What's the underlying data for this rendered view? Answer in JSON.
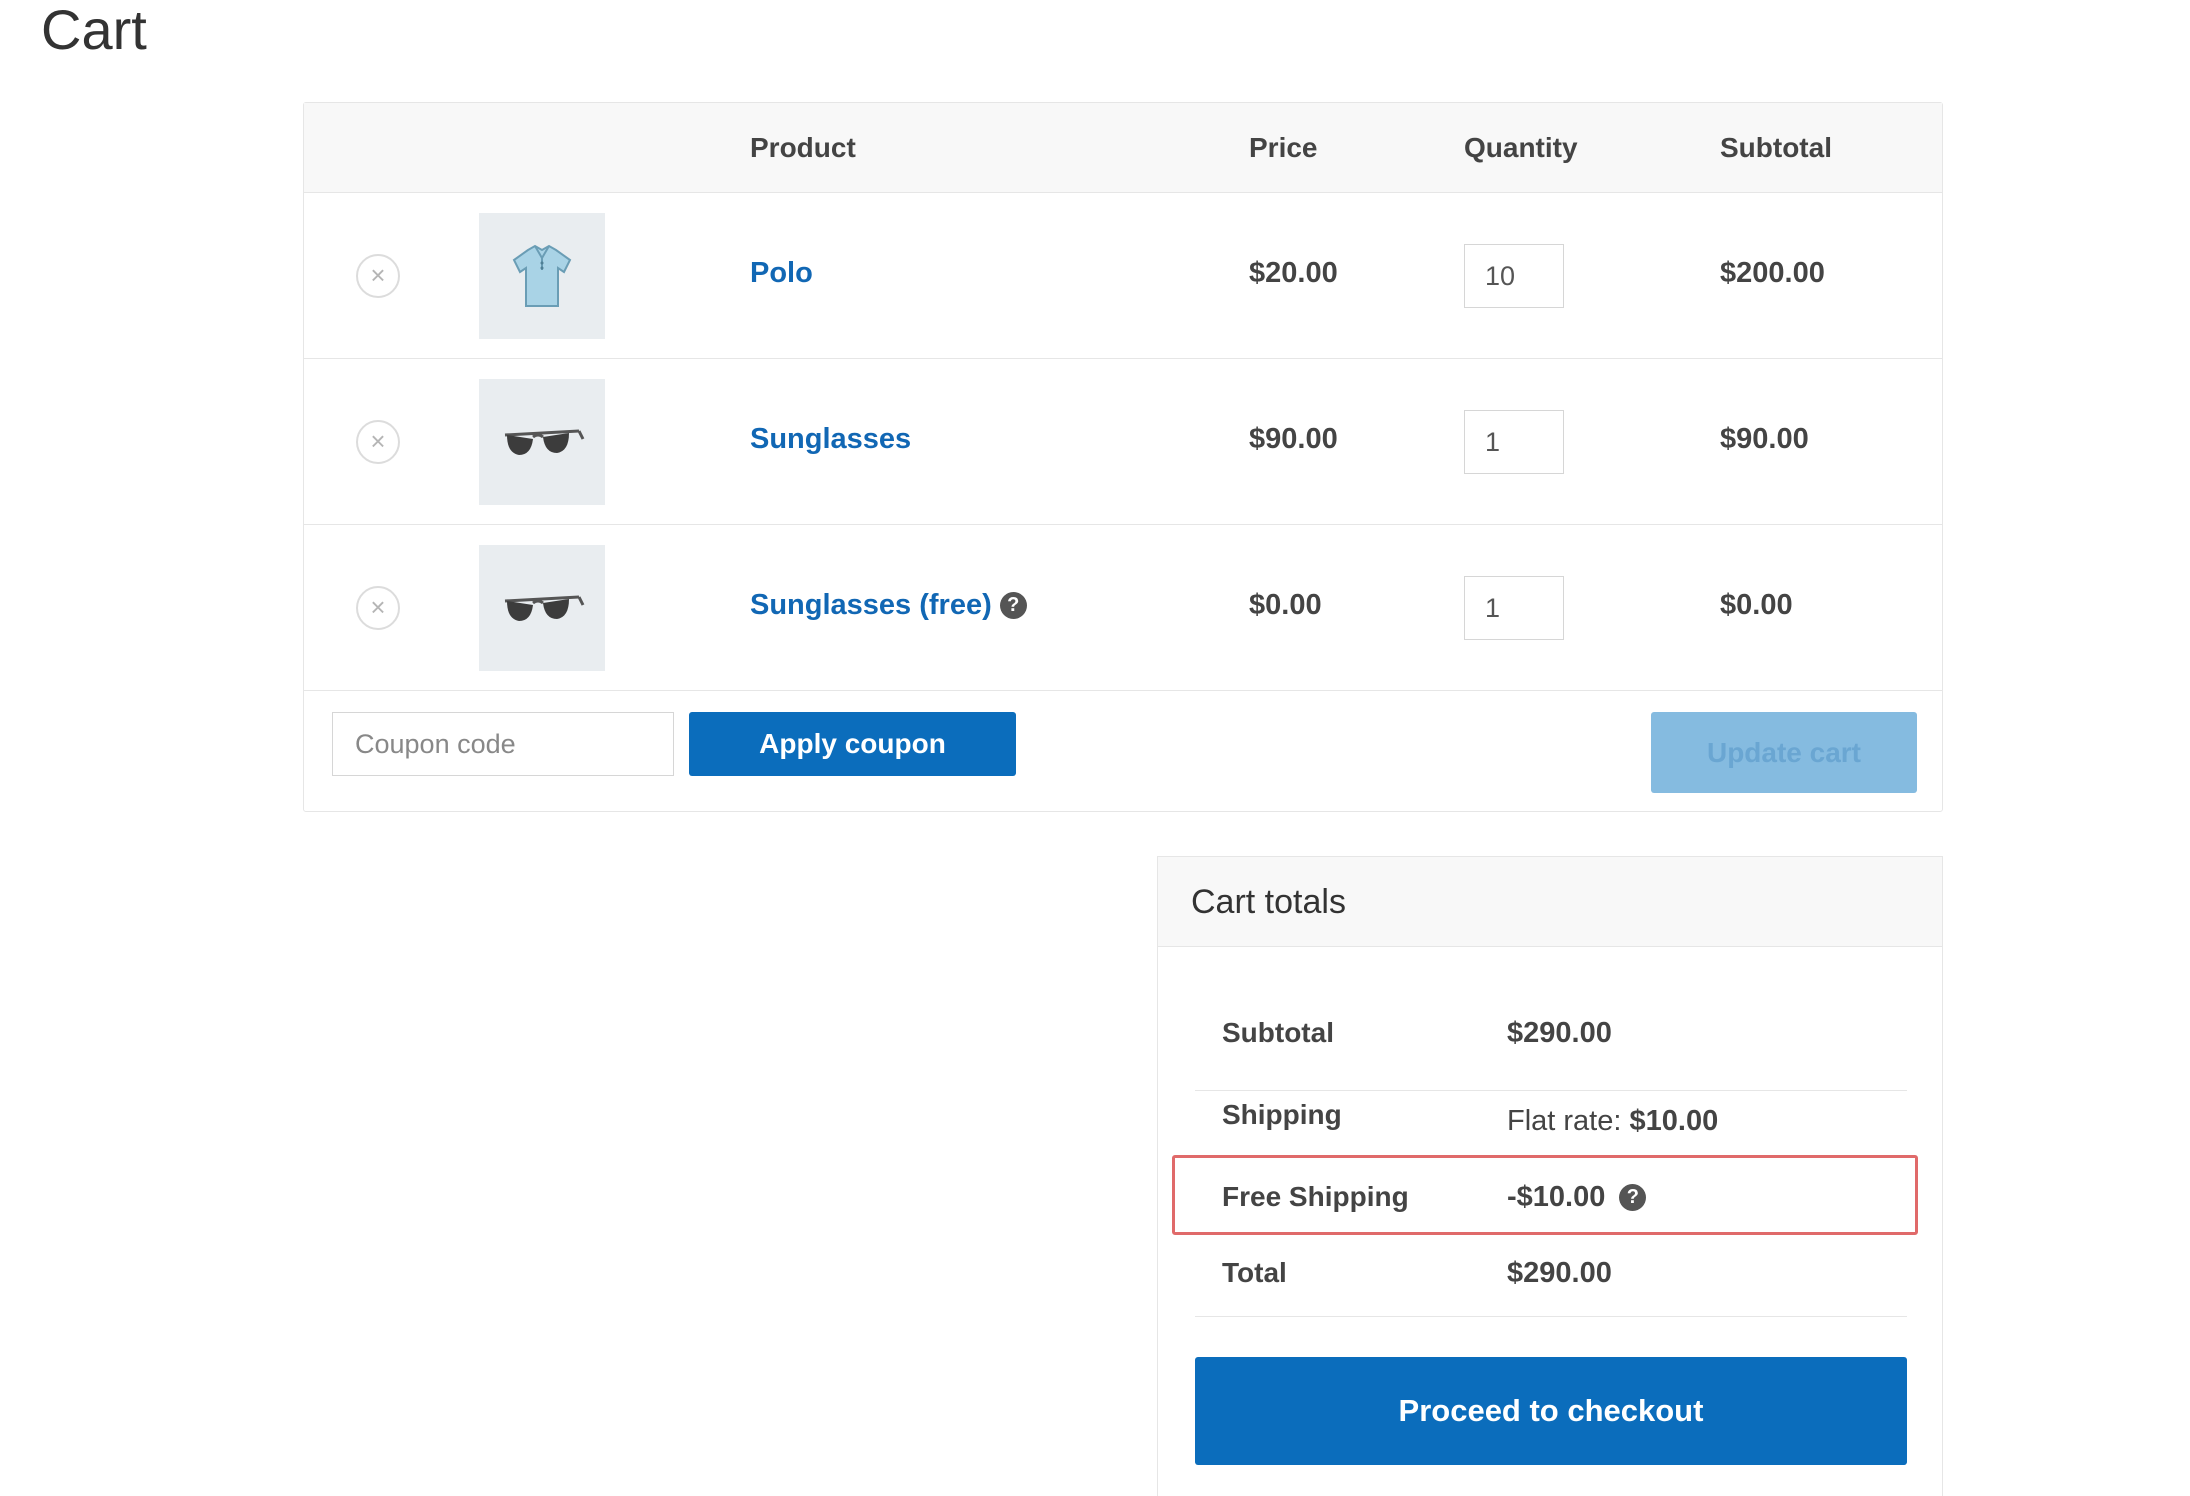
{
  "page": {
    "title": "Cart"
  },
  "cart_table": {
    "headers": {
      "product": "Product",
      "price": "Price",
      "quantity": "Quantity",
      "subtotal": "Subtotal"
    },
    "remove_symbol": "×",
    "items": [
      {
        "name": "Polo",
        "price": "$20.00",
        "quantity": "10",
        "subtotal": "$200.00",
        "thumbnail": "polo-shirt",
        "has_help": false
      },
      {
        "name": "Sunglasses",
        "price": "$90.00",
        "quantity": "1",
        "subtotal": "$90.00",
        "thumbnail": "sunglasses",
        "has_help": false
      },
      {
        "name": "Sunglasses (free)",
        "price": "$0.00",
        "quantity": "1",
        "subtotal": "$0.00",
        "thumbnail": "sunglasses",
        "has_help": true,
        "help_symbol": "?"
      }
    ]
  },
  "actions": {
    "coupon_placeholder": "Coupon code",
    "apply_coupon_label": "Apply coupon",
    "update_cart_label": "Update cart"
  },
  "totals": {
    "title": "Cart totals",
    "subtotal_label": "Subtotal",
    "subtotal_value": "$290.00",
    "shipping_label": "Shipping",
    "shipping_method": "Flat rate:",
    "shipping_amount": "$10.00",
    "free_shipping_label": "Free Shipping",
    "free_shipping_value": "-$10.00",
    "free_shipping_help": "?",
    "total_label": "Total",
    "total_value": "$290.00",
    "checkout_label": "Proceed to checkout"
  },
  "colors": {
    "link": "#1167b4",
    "primary_button": "#0b6dbc",
    "disabled_button": "#85bbe0",
    "highlight": "#e06a6a"
  }
}
